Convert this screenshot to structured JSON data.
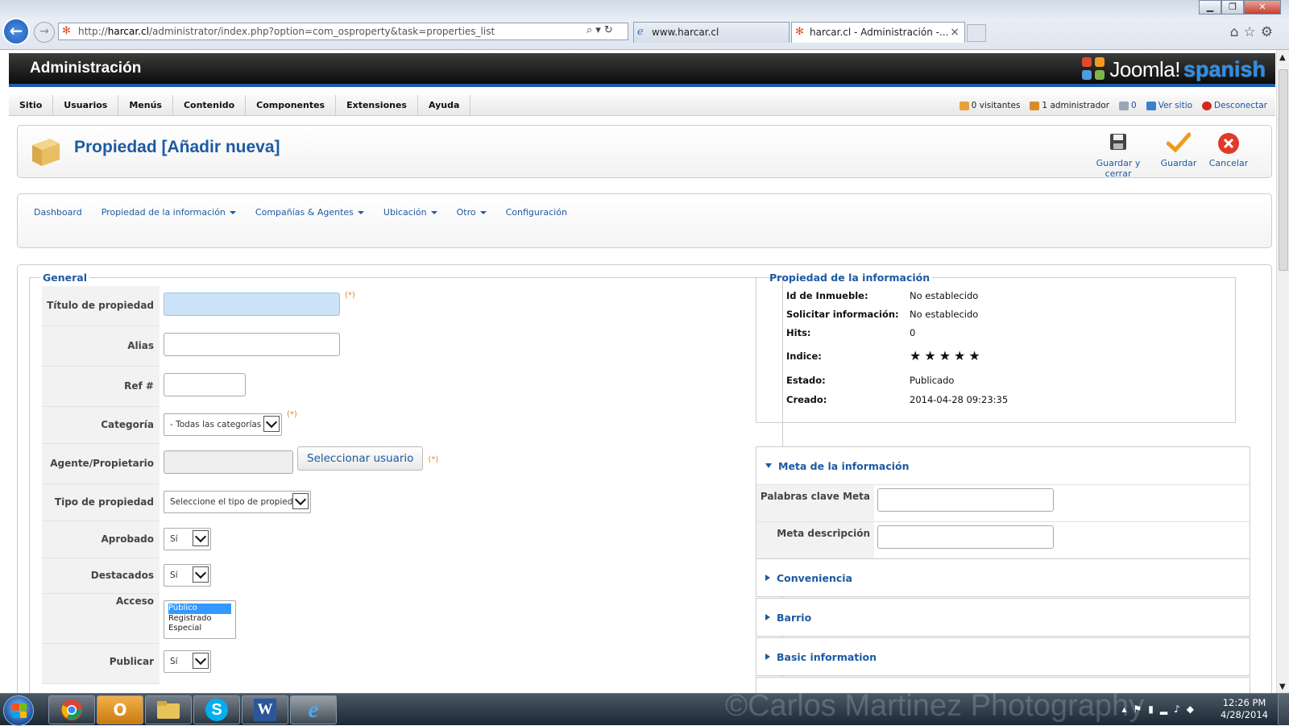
{
  "browser": {
    "url": "http://harcar.cl/administrator/index.php?option=com_osproperty&task=properties_list",
    "url_host": "harcar.cl",
    "url_prefix": "http://",
    "url_path": "/administrator/index.php?option=com_osproperty&task=properties_list",
    "tabs": [
      {
        "label": "www.harcar.cl",
        "active": false
      },
      {
        "label": "harcar.cl - Administración -...",
        "active": true
      }
    ],
    "tab_close": "×"
  },
  "header": {
    "title": "Administración",
    "logo_word": "Joomla!",
    "logo_suffix": "spanish"
  },
  "menu": {
    "items": [
      "Sitio",
      "Usuarios",
      "Menús",
      "Contenido",
      "Componentes",
      "Extensiones",
      "Ayuda"
    ]
  },
  "status": {
    "visitors": "0 visitantes",
    "admins": "1 administrador",
    "messages": "0",
    "view_site": "Ver sitio",
    "logout": "Desconectar"
  },
  "toolbar": {
    "page_title": "Propiedad [Añadir nueva]",
    "save_close_label": "Guardar y cerrar",
    "save_label": "Guardar",
    "cancel_label": "Cancelar"
  },
  "submenu": {
    "items": [
      {
        "label": "Dashboard",
        "dropdown": false
      },
      {
        "label": "Propiedad de la información",
        "dropdown": true
      },
      {
        "label": "Compañías & Agentes",
        "dropdown": true
      },
      {
        "label": "Ubicación",
        "dropdown": true
      },
      {
        "label": "Otro",
        "dropdown": true
      },
      {
        "label": "Configuración",
        "dropdown": false
      }
    ]
  },
  "general": {
    "legend": "General",
    "required_mark": "(*)",
    "fields": {
      "title_label": "Título de propiedad",
      "title_value": "",
      "alias_label": "Alias",
      "alias_value": "",
      "ref_label": "Ref #",
      "ref_value": "",
      "category_label": "Categoría",
      "category_value": "- Todas las categorías -",
      "agent_label": "Agente/Propietario",
      "agent_value": "",
      "select_user_button": "Seleccionar usuario",
      "type_label": "Tipo de propiedad",
      "type_value": "Seleccione el tipo de propiedad",
      "approved_label": "Aprobado",
      "approved_value": "Sí",
      "featured_label": "Destacados",
      "featured_value": "Sí",
      "access_label": "Acceso",
      "access_options": [
        "Público",
        "Registrado",
        "Especial"
      ],
      "access_selected": "Público",
      "publish_label": "Publicar",
      "publish_value": "Sí"
    }
  },
  "info": {
    "legend": "Propiedad de la información",
    "rows": [
      {
        "key": "Id de Inmueble:",
        "value": "No establecido"
      },
      {
        "key": "Solicitar información:",
        "value": "No establecido"
      },
      {
        "key": "Hits:",
        "value": "0"
      },
      {
        "key": "Indice:",
        "value": "★★★★★"
      },
      {
        "key": "Estado:",
        "value": "Publicado"
      },
      {
        "key": "Creado:",
        "value": "2014-04-28 09:23:35"
      }
    ],
    "rating_stars": 5
  },
  "panels": {
    "meta_title": "Meta de la información",
    "meta_keywords_label": "Palabras clave Meta",
    "meta_keywords_value": "",
    "meta_description_label": "Meta descripción",
    "meta_description_value": "",
    "convenience_title": "Conveniencia",
    "neighborhood_title": "Barrio",
    "basic_title": "Basic information"
  },
  "taskbar": {
    "watermark": "©Carlos Martinez Photography",
    "time": "12:26 PM",
    "date": "4/28/2014"
  },
  "colors": {
    "accent": "#1d5aa2",
    "header_bg": "#0c0c0c",
    "required": "#e0872c",
    "logout": "#c1211a",
    "stars": "#e7769c"
  }
}
